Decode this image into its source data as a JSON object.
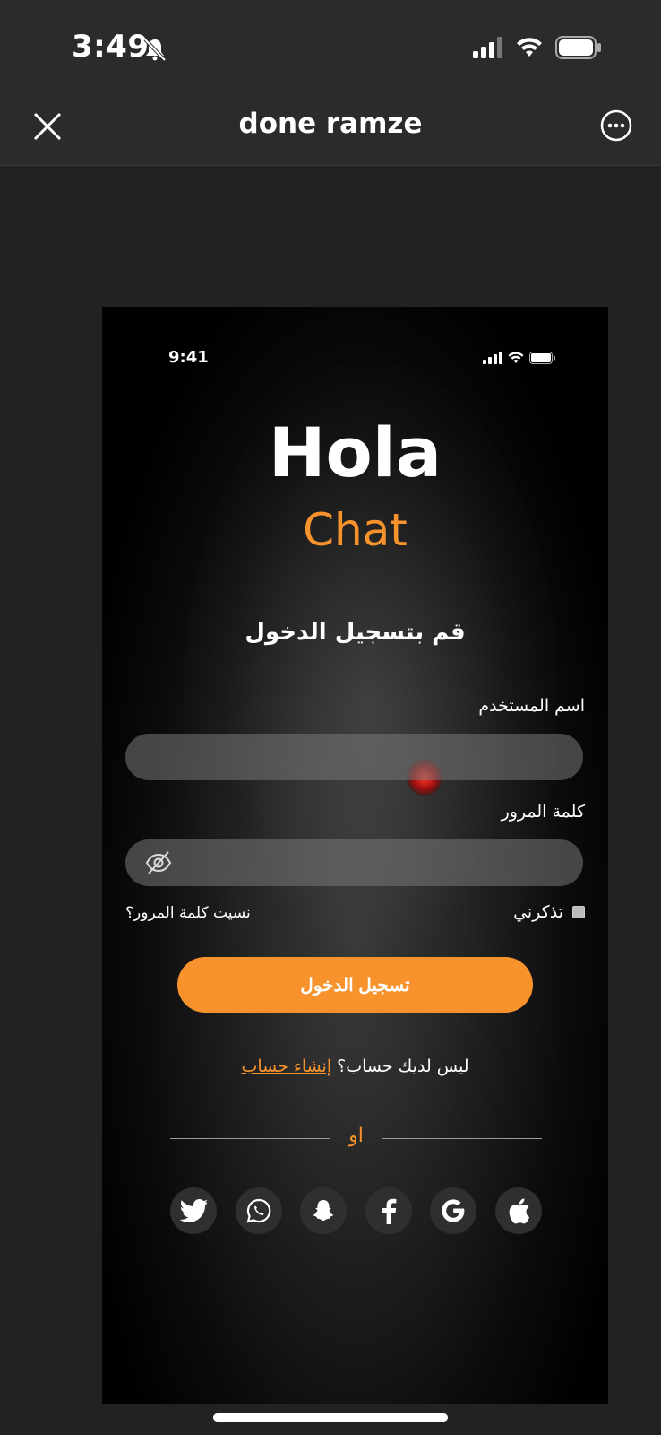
{
  "status_bar": {
    "time": "3:49"
  },
  "nav": {
    "title": "done ramze"
  },
  "mock": {
    "status_time": "9:41",
    "brand_title": "Hola",
    "brand_subtitle": "Chat",
    "login_heading": "قم بتسجيل الدخول",
    "username_label": "اسم المستخدم",
    "username_value": "",
    "password_label": "كلمة المرور",
    "password_value": "",
    "remember_label": "تذكرني",
    "forgot_label": "نسيت كلمة المرور؟",
    "login_button": "تسجيل الدخول",
    "no_account_text": "ليس لديك حساب؟",
    "create_account_link": "إنشاء حساب",
    "or_text": "او",
    "socials": [
      "twitter-icon",
      "whatsapp-icon",
      "snapchat-icon",
      "facebook-icon",
      "google-icon",
      "apple-icon"
    ]
  },
  "colors": {
    "accent": "#f7922c",
    "background": "#222222",
    "field": "#787878"
  }
}
